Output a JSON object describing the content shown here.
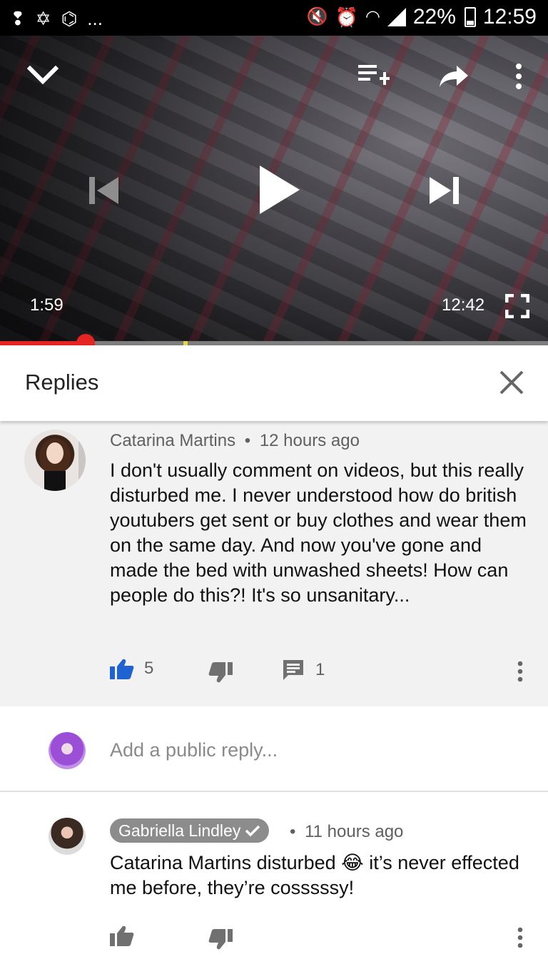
{
  "status_bar": {
    "battery": "22%",
    "time": "12:59",
    "left_extra": "..."
  },
  "player": {
    "current_time": "1:59",
    "duration": "12:42",
    "progress_fraction": 0.156,
    "buffered_fraction": 0.335,
    "colors": {
      "progress": "#e52521",
      "ad_marker": "#e6d54a"
    }
  },
  "replies": {
    "title": "Replies",
    "main_comment": {
      "author": "Catarina Martins",
      "time": "12 hours ago",
      "separator": "•",
      "text": "I don't usually comment on videos, but this really disturbed me. I never understood how do british youtubers get sent or buy clothes and wear them on the same day. And now you've gone and made the bed with unwashed sheets! How can people do this?! It's so unsanitary...",
      "likes": "5",
      "replies_count": "1",
      "like_color": "#1e63d0"
    },
    "reply_input": {
      "placeholder": "Add a public reply..."
    },
    "reply": {
      "author": "Gabriella Lindley",
      "time": "11 hours ago",
      "separator": "•",
      "text": "Catarina Martins disturbed 😂 it’s never effected me before, they’re cosssssy!"
    }
  },
  "icons": {
    "collapse": "chevron-down-icon",
    "add_to_playlist": "playlist-add-icon",
    "share": "share-icon",
    "more": "more-vert-icon",
    "previous": "skip-previous-icon",
    "play": "play-icon",
    "next": "skip-next-icon",
    "fullscreen": "fullscreen-icon",
    "close": "close-icon",
    "like": "thumb-up-icon",
    "dislike": "thumb-down-icon",
    "reply": "comment-icon"
  }
}
